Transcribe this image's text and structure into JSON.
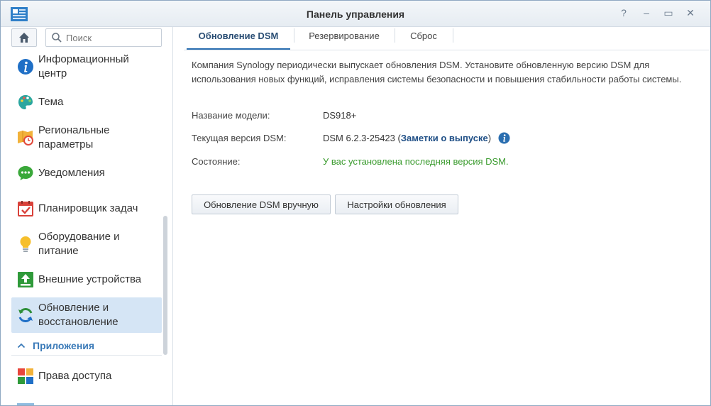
{
  "window": {
    "title": "Панель управления",
    "help_glyph": "?",
    "minimize_glyph": "–",
    "maximize_glyph": "▭",
    "close_glyph": "✕"
  },
  "sidebar": {
    "search": {
      "placeholder": "Поиск",
      "value": ""
    },
    "items": [
      {
        "label": "Информационный центр",
        "icon": "info-icon"
      },
      {
        "label": "Тема",
        "icon": "palette-icon"
      },
      {
        "label": "Региональные параметры",
        "icon": "regional-clock-icon"
      },
      {
        "label": "Уведомления",
        "icon": "chat-bubble-icon"
      },
      {
        "label": "Планировщик задач",
        "icon": "calendar-check-icon"
      },
      {
        "label": "Оборудование и питание",
        "icon": "lightbulb-icon"
      },
      {
        "label": "Внешние устройства",
        "icon": "upload-arrow-icon"
      },
      {
        "label": "Обновление и восстановление",
        "icon": "refresh-icon",
        "active": true
      }
    ],
    "section": {
      "label": "Приложения"
    },
    "app_items": [
      {
        "label": "Права доступа",
        "icon": "app-grid-icon"
      }
    ]
  },
  "tabs": [
    {
      "label": "Обновление DSM",
      "active": true
    },
    {
      "label": "Резервирование"
    },
    {
      "label": "Сброс"
    }
  ],
  "content": {
    "description": "Компания Synology периодически выпускает обновления DSM. Установите обновленную версию DSM для использования новых функций, исправления системы безопасности и повышения стабильности работы системы.",
    "model_label": "Название модели:",
    "model_value": "DS918+",
    "version_label": "Текущая версия DSM:",
    "version_value": "DSM 6.2.3-25423 (",
    "release_notes_link": "Заметки о выпуске",
    "version_suffix": ")",
    "status_label": "Состояние:",
    "status_value": "У вас установлена последняя версия DSM.",
    "manual_update_button": "Обновление DSM вручную",
    "update_settings_button": "Настройки обновления"
  },
  "colors": {
    "accent": "#2a6eb0",
    "active_item_bg": "#d5e5f5",
    "status_ok": "#3a9b2e",
    "link": "#1f4f86"
  }
}
